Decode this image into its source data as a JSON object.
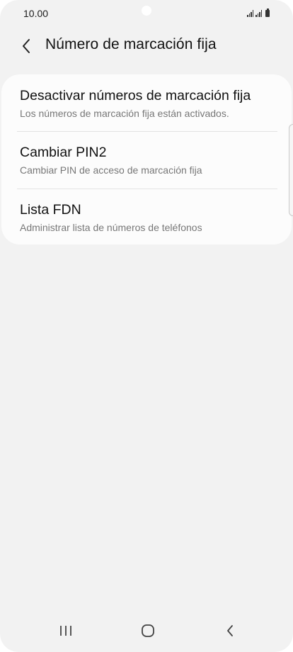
{
  "status_bar": {
    "time": "10.00"
  },
  "header": {
    "back_icon": "chevron-left-icon",
    "title": "Número de marcación fija"
  },
  "settings": {
    "items": [
      {
        "title": "Desactivar números de marcación fija",
        "subtitle": "Los números de marcación fija están activados."
      },
      {
        "title": "Cambiar PIN2",
        "subtitle": "Cambiar PIN de acceso de marcación fija"
      },
      {
        "title": "Lista FDN",
        "subtitle": "Administrar lista de números de teléfonos"
      }
    ]
  },
  "nav_bar": {
    "recents_icon": "recents-icon",
    "home_icon": "home-icon",
    "back_icon": "back-icon"
  },
  "colors": {
    "background": "#f2f2f2",
    "card": "#fcfcfc",
    "text_primary": "#111111",
    "text_secondary": "#777777"
  }
}
